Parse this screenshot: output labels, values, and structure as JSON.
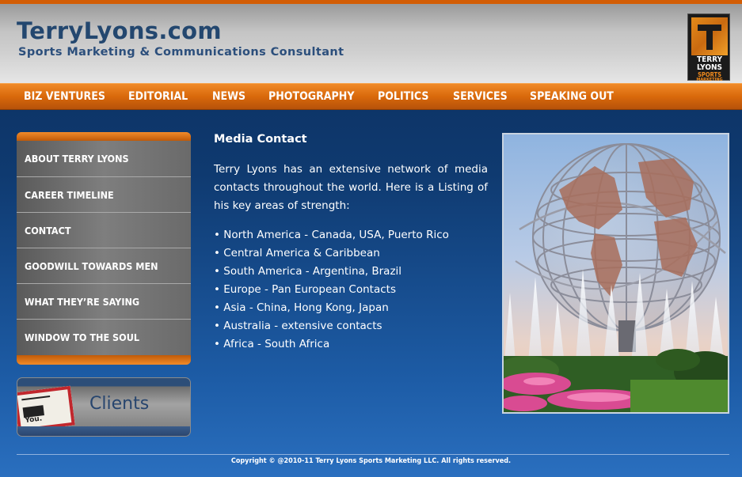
{
  "header": {
    "site_title": "TerryLyons.com",
    "subtitle": "Sports Marketing & Communications Consultant",
    "logo": {
      "line1": "TERRY",
      "line2": "LYONS",
      "line3": "SPORTS",
      "line4": "MARKETING"
    }
  },
  "nav": {
    "items": [
      {
        "label": "BIZ VENTURES"
      },
      {
        "label": "EDITORIAL"
      },
      {
        "label": "NEWS"
      },
      {
        "label": "PHOTOGRAPHY"
      },
      {
        "label": "POLITICS"
      },
      {
        "label": "SERVICES"
      },
      {
        "label": "SPEAKING OUT"
      }
    ]
  },
  "sidebar": {
    "items": [
      {
        "label": "ABOUT TERRY LYONS"
      },
      {
        "label": "CAREER TIMELINE"
      },
      {
        "label": "CONTACT"
      },
      {
        "label": "GOODWILL TOWARDS MEN"
      },
      {
        "label": "WHAT THEY’RE SAYING"
      },
      {
        "label": "WINDOW TO THE SOUL"
      }
    ],
    "clients": {
      "label": "Clients",
      "thumb_text": "You."
    }
  },
  "main": {
    "title": "Media Contact",
    "intro": "Terry Lyons has an extensive network of media contacts throughout the world. Here is a Listing of his key areas of strength:",
    "regions": [
      "• North America - Canada, USA, Puerto Rico",
      "• Central America & Caribbean",
      "• South America - Argentina, Brazil",
      "• Europe - Pan European Contacts",
      "• Asia - China, Hong Kong, Japan",
      "• Australia - extensive contacts",
      "• Africa - South Africa"
    ]
  },
  "footer": {
    "copyright": "Copyright © @2010-11 Terry Lyons Sports Marketing LLC. All rights reserved."
  },
  "colors": {
    "accent_orange": "#d9690b",
    "title_blue": "#23476f",
    "page_blue": "#0f3a70"
  }
}
